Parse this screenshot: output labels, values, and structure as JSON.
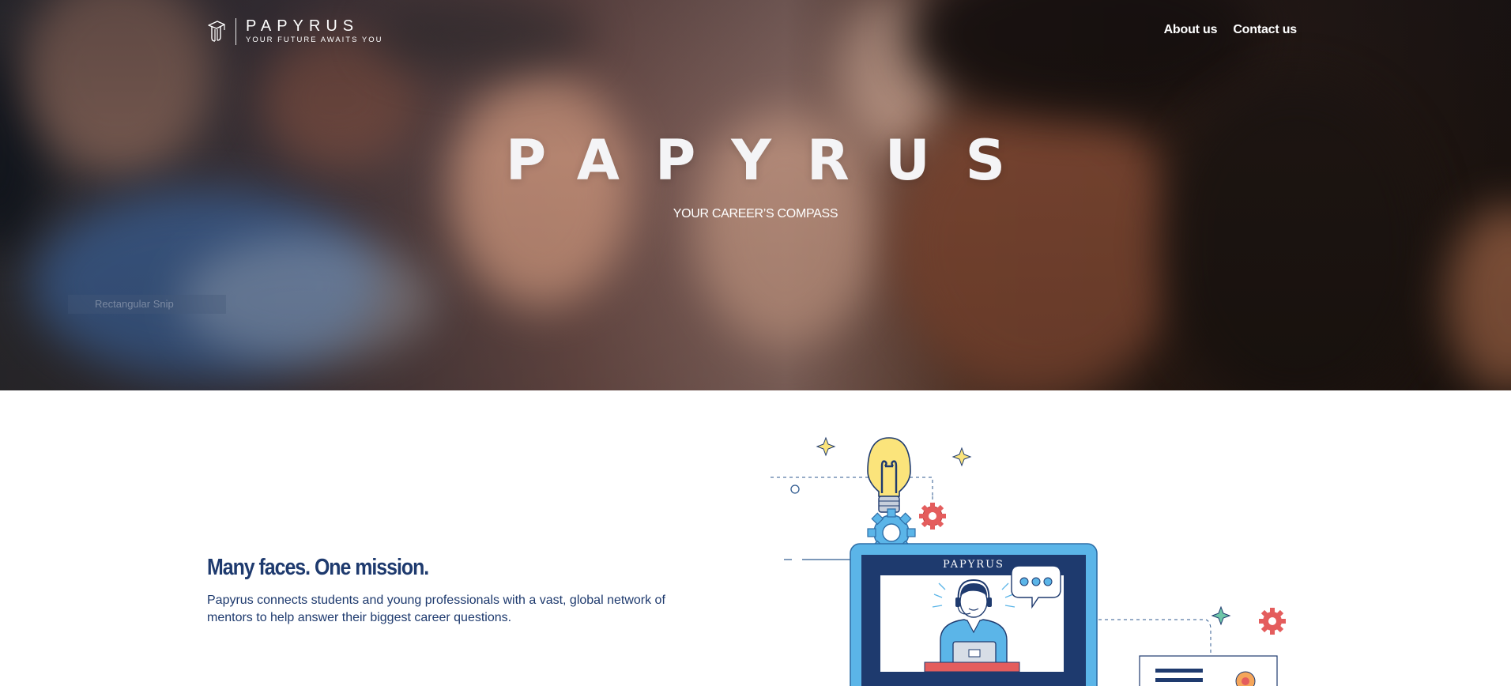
{
  "header": {
    "logo_name": "PAPYRUS",
    "logo_tagline": "YOUR FUTURE AWAITS YOU",
    "logo_icon": "graduation-cap-icon",
    "nav": [
      {
        "label": "About us"
      },
      {
        "label": "Contact us"
      }
    ]
  },
  "hero": {
    "title": "PAPYRUS",
    "subtitle": "YOUR CAREER’S COMPASS",
    "overlay_label": "Rectangular Snip"
  },
  "mission": {
    "heading": "Many faces. One mission.",
    "body": "Papyrus connects students and young professionals with a vast, global network of mentors to help answer their biggest career questions."
  },
  "illustration": {
    "screen_label": "PAPYRUS",
    "icons": [
      "lightbulb-icon",
      "gear-icon",
      "sparkle-icon",
      "headset-mentor-icon",
      "chat-bubble-icon",
      "document-icon"
    ]
  },
  "colors": {
    "navy": "#1e3a6e",
    "sky": "#5bb5e8",
    "coral": "#e45d5d",
    "yellow": "#fbe47b",
    "white": "#ffffff"
  }
}
